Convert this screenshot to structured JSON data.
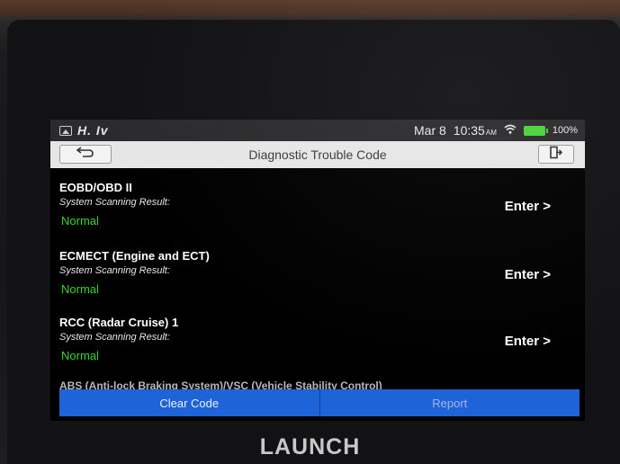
{
  "status_bar": {
    "signal_text": "H. Iv",
    "date": "Mar 8",
    "time": "10:35",
    "ampm": "AM",
    "battery": "100%",
    "icons": [
      "gallery-icon",
      "wifi-icon",
      "battery-icon"
    ],
    "battery_color": "#4cd33a"
  },
  "header": {
    "title": "Diagnostic Trouble Code",
    "back_icon": "back-arrow-icon",
    "exit_icon": "exit-icon"
  },
  "systems": [
    {
      "name": "EOBD/OBD II",
      "label": "System Scanning Result:",
      "status": "Normal",
      "action": "Enter >"
    },
    {
      "name": "ECMECT (Engine and ECT)",
      "label": "System Scanning Result:",
      "status": "Normal",
      "action": "Enter >"
    },
    {
      "name": "RCC (Radar Cruise) 1",
      "label": "System Scanning Result:",
      "status": "Normal",
      "action": "Enter >"
    }
  ],
  "partial_row": "ABS (Anti-lock Braking System)/VSC (Vehicle Stability Control)",
  "buttons": {
    "clear_code": "Clear Code",
    "report": "Report"
  },
  "colors": {
    "accent_blue": "#1f63d9",
    "status_green": "#36d52c",
    "title_bar": "#e6e6e6"
  },
  "brand": "LAUNCH"
}
